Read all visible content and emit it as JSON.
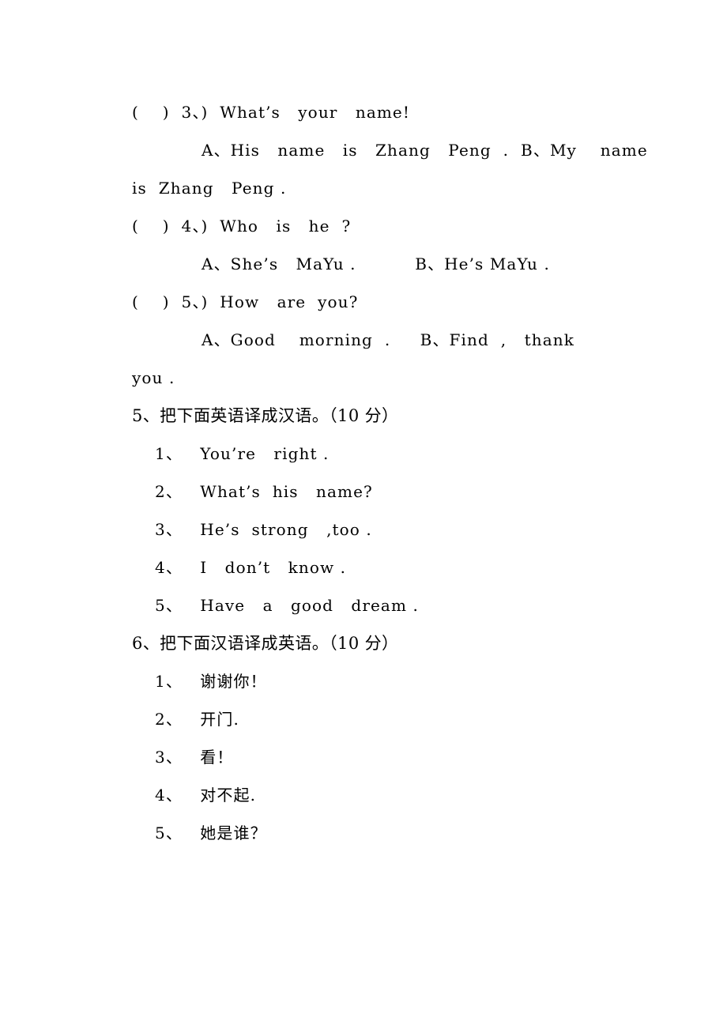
{
  "document": {
    "background_color": "#ffffff",
    "text_color": "#000000",
    "language": "zh-CN / en"
  },
  "multiple_choice_tail": {
    "questions": [
      {
        "marker": "(    )  3、)",
        "stem": "(    )  3、)  What’s   your   name!",
        "options_line_1": "A、His   name   is   Zhang   Peng  .  B、My    name",
        "options_line_2": "is  Zhang   Peng ."
      },
      {
        "marker": "(    )  4、)",
        "stem": "(    )  4、)  Who   is   he  ?",
        "options_line_1": "A、She’s   MaYu .          B、He’s MaYu ."
      },
      {
        "marker": "(    )  5、)",
        "stem": "(    )  5、)  How   are  you?",
        "options_line_1": "A、Good    morning  .     B、Find  ,   thank",
        "options_line_2": "you ."
      }
    ]
  },
  "section_5": {
    "heading": "5、把下面英语译成汉语。（10 分）",
    "items": [
      "1、   You’re   right .",
      "2、   What’s  his   name?",
      "3、   He’s  strong   ,too .",
      "4、   I   don’t   know .",
      "5、   Have   a   good   dream ."
    ]
  },
  "section_6": {
    "heading": "6、把下面汉语译成英语。（10 分）",
    "items": [
      "1、   谢谢你！",
      "2、   开门.",
      "3、   看！",
      "4、   对不起.",
      "5、   她是谁？"
    ]
  }
}
